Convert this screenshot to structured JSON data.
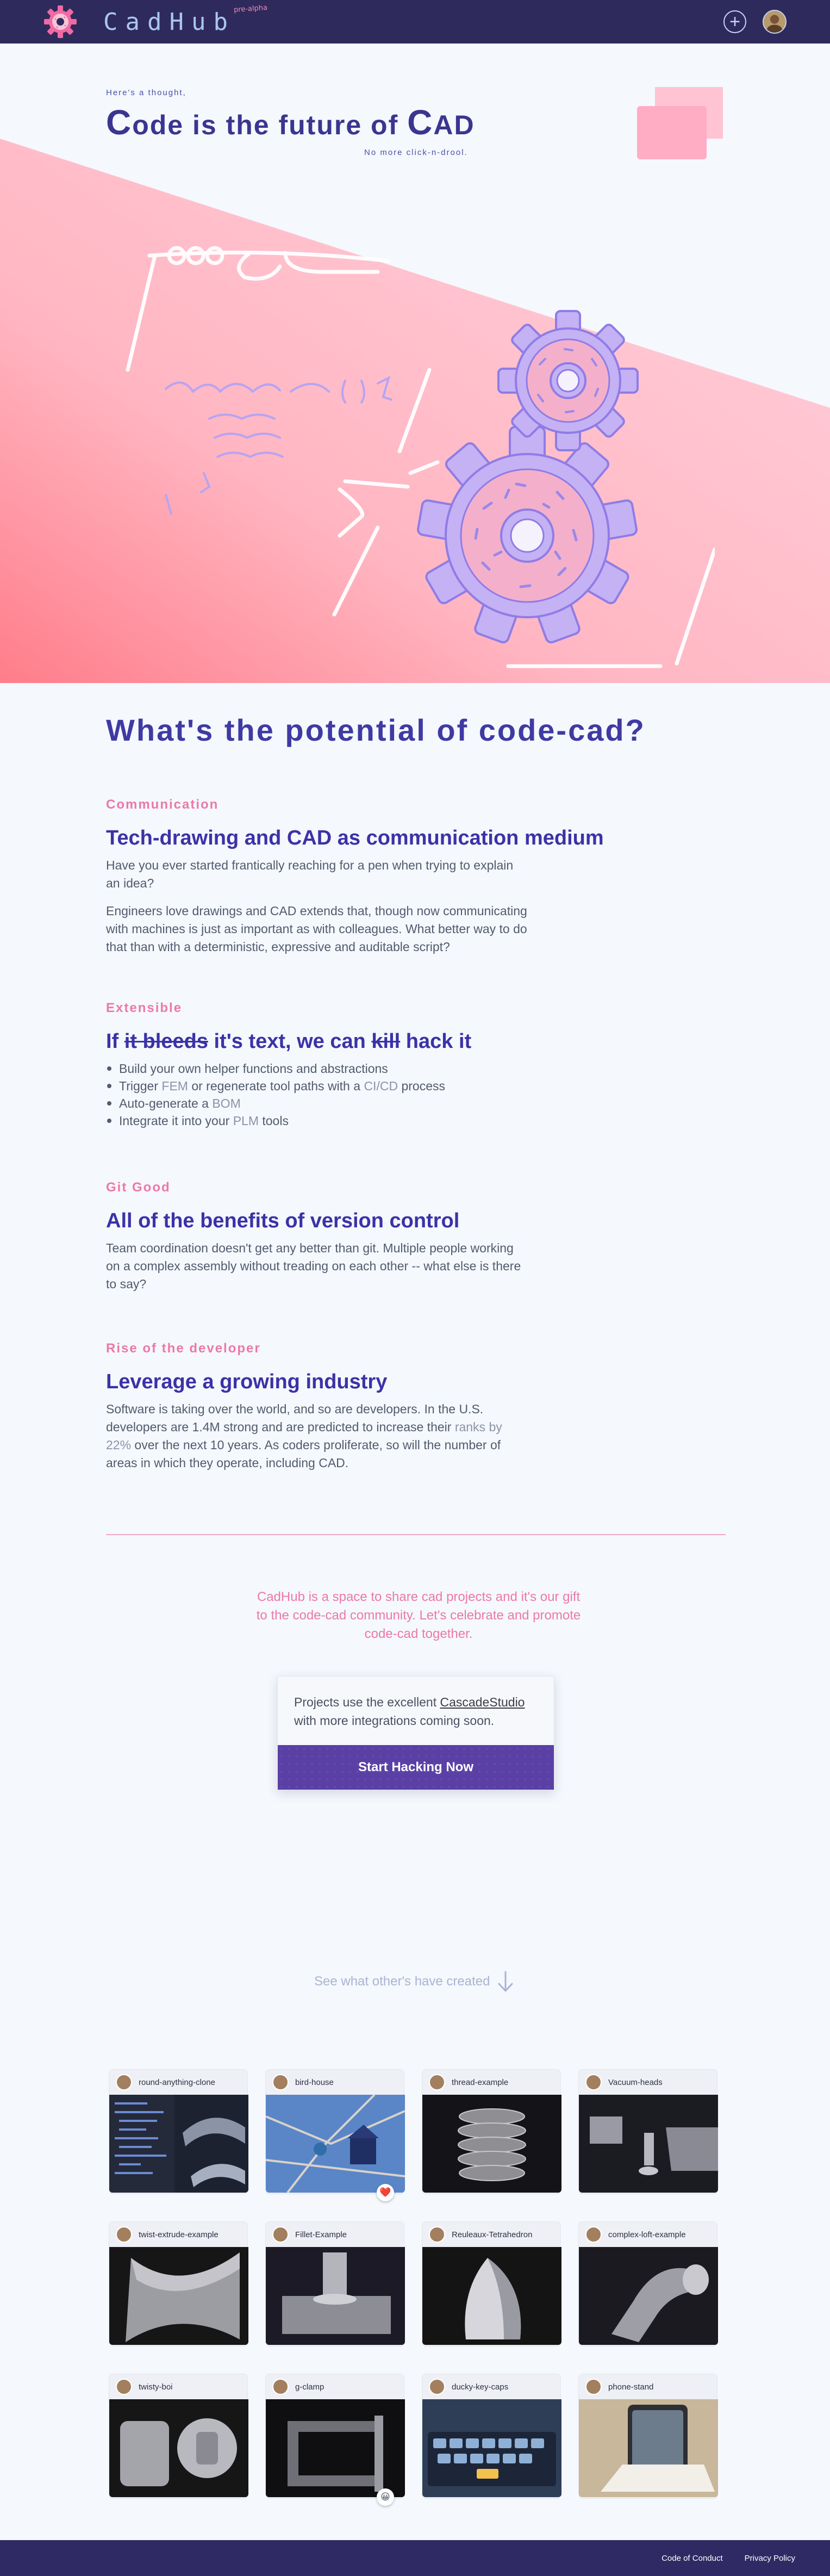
{
  "header": {
    "brand": "CadHub",
    "alpha_badge": "pre-alpha",
    "add_icon": "plus-circle-icon",
    "avatar_icon": "user-avatar"
  },
  "hero": {
    "eyebrow": "Here's a thought,",
    "title_pre": "C",
    "title_mid": "ode is the future of ",
    "title_cad_c": "C",
    "title_cad_rest": "AD",
    "subtitle": "No more click-n-drool.",
    "colors": {
      "pink": "#ffb5c8",
      "lavender": "#c6b8f7",
      "navy": "#3b3590"
    }
  },
  "potential": {
    "title": "What's the potential of code-cad?"
  },
  "benefits": {
    "communication": {
      "eyebrow": "Communication",
      "heading": "Tech-drawing and CAD as communication medium",
      "p1": "Have you ever started frantically reaching for a pen when trying to explain an idea?",
      "p2": "Engineers love drawings and CAD extends that, though now communicating with machines is just as important as with colleagues. What better way to do that than with a deterministic, expressive and auditable script?"
    },
    "extensible": {
      "eyebrow": "Extensible",
      "h_if": "If ",
      "h_bleeds": "it bleeds",
      "h_mid": " it's text, we can ",
      "h_kill": "kill",
      "h_end": " hack it",
      "li1": "Build your own helper functions and abstractions",
      "li2_a": "Trigger ",
      "li2_fem": "FEM",
      "li2_b": " or regenerate tool paths with a ",
      "li2_cicd": "CI/CD",
      "li2_c": " process",
      "li3_a": "Auto-generate a ",
      "li3_bom": "BOM",
      "li4_a": "Integrate it into your ",
      "li4_plm": "PLM",
      "li4_b": " tools"
    },
    "gitgood": {
      "eyebrow": "Git Good",
      "heading": "All of the benefits of version control",
      "p1": "Team coordination doesn't get any better than git. Multiple people working on a complex assembly without treading on each other -- what else is there to say?"
    },
    "developer": {
      "eyebrow": "Rise of the developer",
      "heading": "Leverage a growing industry",
      "p_a": "Software is taking over the world, and so are developers. In the U.S. developers are 1.4M strong and are predicted to increase their ",
      "p_link": "ranks by 22%",
      "p_b": " over the next 10 years. As coders proliferate, so will the number of areas in which they operate, including CAD."
    }
  },
  "mission": "CadHub is a space to share cad projects and it's our gift to the code-cad community. Let's celebrate and promote code-cad together.",
  "cta_card": {
    "text_a": "Projects use the excellent ",
    "link": "CascadeStudio",
    "text_b": " with more integrations coming soon.",
    "button": "Start Hacking Now"
  },
  "see_created": {
    "label": "See what other's have created",
    "icon": "arrow-down-icon"
  },
  "projects": [
    {
      "title": "round-anything-clone",
      "thumb": "code-screenshot"
    },
    {
      "title": "bird-house",
      "thumb": "photo-birdhouse",
      "reaction": "❤️"
    },
    {
      "title": "thread-example",
      "thumb": "render-thread"
    },
    {
      "title": "Vacuum-heads",
      "thumb": "render-vacuum"
    },
    {
      "title": "twist-extrude-example",
      "thumb": "render-twist"
    },
    {
      "title": "Fillet-Example",
      "thumb": "render-fillet"
    },
    {
      "title": "Reuleaux-Tetrahedron",
      "thumb": "render-reuleaux"
    },
    {
      "title": "complex-loft-example",
      "thumb": "render-loft"
    },
    {
      "title": "twisty-boi",
      "thumb": "render-twisty"
    },
    {
      "title": "g-clamp",
      "thumb": "render-gclamp",
      "reaction": "😀"
    },
    {
      "title": "ducky-key-caps",
      "thumb": "photo-keyboard"
    },
    {
      "title": "phone-stand",
      "thumb": "photo-phone-stand"
    }
  ],
  "footer": {
    "conduct": "Code of Conduct",
    "privacy": "Privacy Policy"
  }
}
